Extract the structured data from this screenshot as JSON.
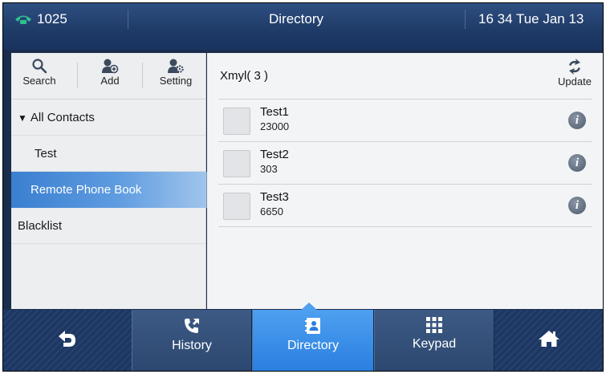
{
  "status_bar": {
    "line_number": "1025",
    "title": "Directory",
    "clock": "16 34 Tue Jan 13"
  },
  "toolbar": {
    "search_label": "Search",
    "add_label": "Add",
    "setting_label": "Setting"
  },
  "nav": {
    "all_contacts": "All Contacts",
    "items": [
      {
        "label": "Test"
      },
      {
        "label": "Remote Phone Book"
      },
      {
        "label": "Blacklist"
      }
    ]
  },
  "group": {
    "header": "Xmyl( 3 )",
    "update_label": "Update"
  },
  "contacts": [
    {
      "name": "Test1",
      "number": "23000"
    },
    {
      "name": "Test2",
      "number": "303"
    },
    {
      "name": "Test3",
      "number": "6650"
    }
  ],
  "bottom_bar": {
    "history_label": "History",
    "directory_label": "Directory",
    "keypad_label": "Keypad"
  },
  "colors": {
    "accent": "#4ea0f0",
    "status_bar": "#1e3a66",
    "line_icon": "#2fbf8f"
  }
}
